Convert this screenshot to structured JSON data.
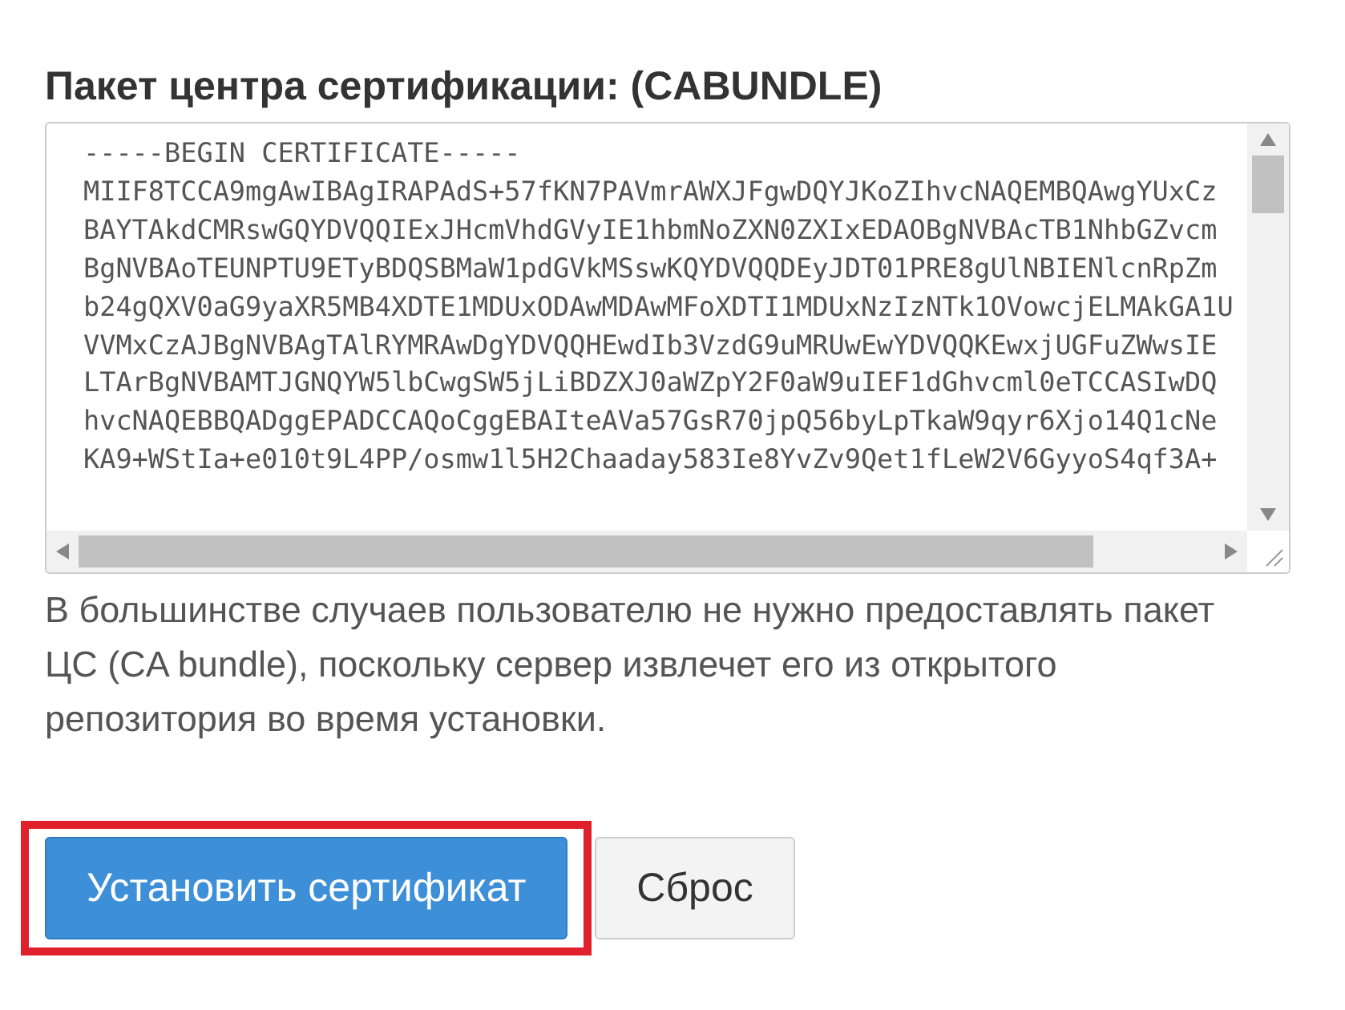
{
  "field": {
    "label": "Пакет центра сертификации: (CABUNDLE)",
    "lines": [
      "-----BEGIN CERTIFICATE-----",
      "MIIF8TCCA9mgAwIBAgIRAPAdS+57fKN7PAVmrAWXJFgwDQYJKoZIhvcNAQEMBQAwgYUxCz",
      "BAYTAkdCMRswGQYDVQQIExJHcmVhdGVyIE1hbmNoZXN0ZXIxEDAOBgNVBAcTB1NhbGZvcm",
      "BgNVBAoTEUNPTU9ETyBDQSBMaW1pdGVkMSswKQYDVQQDEyJDT01PRE8gUlNBIENlcnRpZm",
      "b24gQXV0aG9yaXR5MB4XDTE1MDUxODAwMDAwMFoXDTI1MDUxNzIzNTk1OVowcjELMAkGA1U",
      "VVMxCzAJBgNVBAgTAlRYMRAwDgYDVQQHEwdIb3VzdG9uMRUwEwYDVQQKEwxjUGFuZWwsIE",
      "LTArBgNVBAMTJGNQYW5lbCwgSW5jLiBDZXJ0aWZpY2F0aW9uIEF1dGhvcml0eTCCASIwDQ",
      "hvcNAQEBBQADggEPADCCAQoCggEBAIteAVa57GsR70jpQ56byLpTkaW9qyr6Xjo14Q1cNe",
      "KA9+WStIa+e010t9L4PP/osmw1l5H2Chaaday583Ie8YvZv9Qet1fLeW2V6GyyoS4qf3A+"
    ],
    "help": "В большинстве случаев пользователю не нужно предоставлять пакет ЦС (CA bundle), поскольку сервер извлечет его из открытого репозитория во время установки."
  },
  "buttons": [
    {
      "label": "Установить сертификат",
      "kind": "primary",
      "highlighted": true
    },
    {
      "label": "Сброс",
      "kind": "default",
      "highlighted": false
    }
  ]
}
